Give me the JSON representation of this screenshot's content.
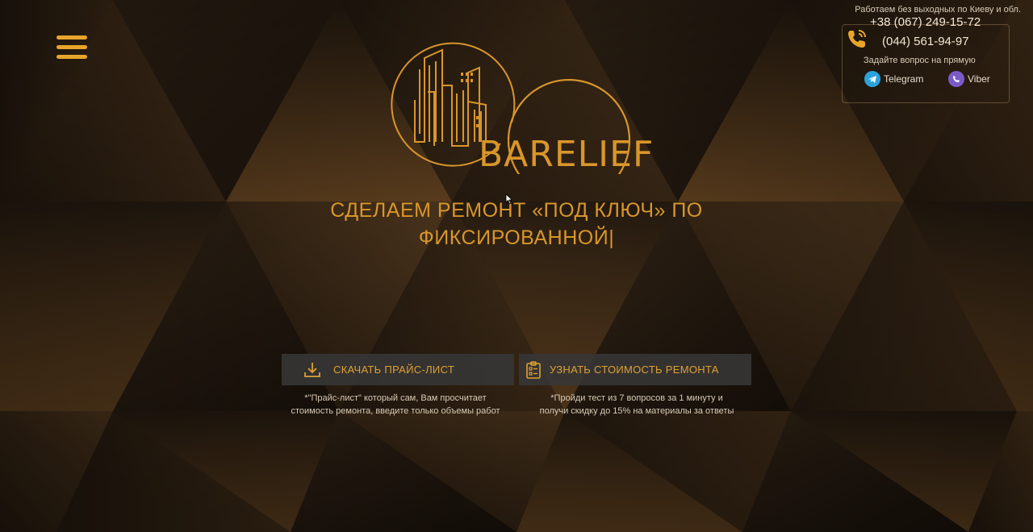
{
  "brand": {
    "logo_text": "BARELIEF"
  },
  "menu": {
    "icon": "hamburger-menu-icon"
  },
  "contacts": {
    "work_hours": "Работаем без выходных по Киеву и обл.",
    "phone1": "+38 (067) 249-15-72",
    "phone2": "(044) 561-94-97",
    "ask_label": "Задайте вопрос на прямую",
    "telegram_label": "Telegram",
    "viber_label": "Viber"
  },
  "hero": {
    "headline_line1": "СДЕЛАЕМ РЕМОНТ «ПОД КЛЮЧ» ПО",
    "headline_line2": "ФИКСИРОВАННОЙ|"
  },
  "actions": {
    "price_button": "СКАЧАТЬ ПРАЙС-ЛИСТ",
    "price_note": "*\"Прайс-лист\" который сам, Вам просчитает стоимость ремонта, введите только объемы работ",
    "cost_button": "УЗНАТЬ СТОИМОСТЬ РЕМОНТА",
    "cost_note": "*Пройди тест из 7 вопросов за 1 минуту и получи скидку до 15% на материалы за ответы"
  },
  "colors": {
    "accent": "#d9962a",
    "burger": "#e8a52a",
    "button_bg": "#373737"
  }
}
